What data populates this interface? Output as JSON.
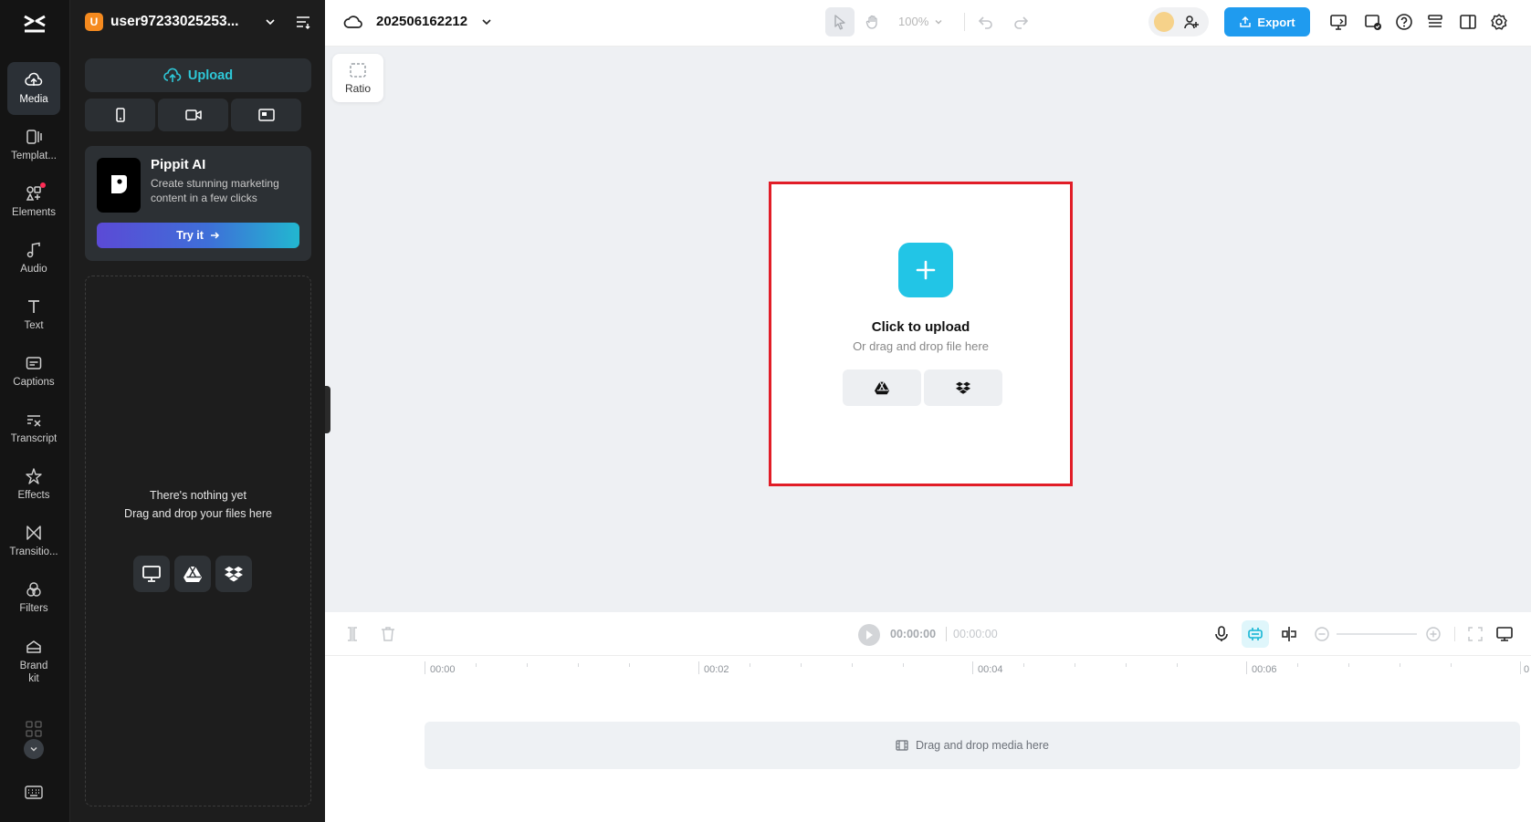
{
  "rail": {
    "items": [
      {
        "label": "Media",
        "icon": "cloud-upload-icon",
        "active": true
      },
      {
        "label": "Templat...",
        "icon": "template-icon"
      },
      {
        "label": "Elements",
        "icon": "elements-icon",
        "badge_dot": true
      },
      {
        "label": "Audio",
        "icon": "music-note-icon"
      },
      {
        "label": "Text",
        "icon": "text-icon"
      },
      {
        "label": "Captions",
        "icon": "captions-icon"
      },
      {
        "label": "Transcript",
        "icon": "transcript-icon"
      },
      {
        "label": "Effects",
        "icon": "effects-star-icon"
      },
      {
        "label": "Transitio...",
        "icon": "transition-icon"
      },
      {
        "label": "Filters",
        "icon": "filters-icon"
      },
      {
        "label": "Brand\nkit",
        "icon": "brand-kit-icon"
      }
    ]
  },
  "panel": {
    "user_initial": "U",
    "user_name": "user97233025253...",
    "upload_label": "Upload",
    "promo": {
      "title": "Pippit AI",
      "description": "Create stunning marketing content in a few clicks",
      "button_label": "Try it"
    },
    "empty_line1": "There's nothing yet",
    "empty_line2": "Drag and drop your files here"
  },
  "topbar": {
    "project_name": "202506162212",
    "zoom_label": "100%",
    "export_label": "Export"
  },
  "canvas": {
    "ratio_label": "Ratio",
    "upload_title": "Click to upload",
    "upload_subtitle": "Or drag and drop file here"
  },
  "timeline": {
    "current_time": "00:00:00",
    "total_time": "00:00:00",
    "ruler_labels": [
      "00:00",
      "00:02",
      "00:04",
      "00:06",
      "0"
    ],
    "track_hint": "Drag and drop media here"
  },
  "colors": {
    "accent_cyan": "#22c5e6",
    "export_blue": "#1f9bef",
    "highlight_red": "#e11d27",
    "rail_bg": "#141414",
    "panel_bg": "#1d1d1d"
  }
}
